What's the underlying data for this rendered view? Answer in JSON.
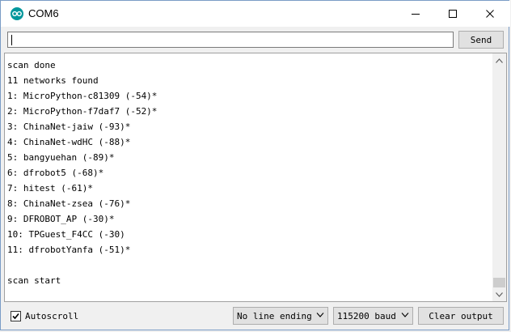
{
  "window": {
    "title": "COM6"
  },
  "input": {
    "value": ""
  },
  "buttons": {
    "send": "Send",
    "clear": "Clear output"
  },
  "output": {
    "lines": [
      "scan done",
      "11 networks found",
      "1: MicroPython-c81309 (-54)*",
      "2: MicroPython-f7daf7 (-52)*",
      "3: ChinaNet-jaiw (-93)*",
      "4: ChinaNet-wdHC (-88)*",
      "5: bangyuehan (-89)*",
      "6: dfrobot5 (-68)*",
      "7: hitest (-61)*",
      "8: ChinaNet-zsea (-76)*",
      "9: DFROBOT_AP (-30)*",
      "10: TPGuest_F4CC (-30)",
      "11: dfrobotYanfa (-51)*",
      "",
      "scan start"
    ]
  },
  "footer": {
    "autoscroll_label": "Autoscroll",
    "autoscroll_checked": true,
    "line_ending": "No line ending",
    "baud": "115200 baud"
  },
  "colors": {
    "accent": "#00979c"
  },
  "icons": {
    "app": "arduino-icon",
    "minimize": "minimize-icon",
    "maximize": "maximize-icon",
    "close": "close-icon",
    "check": "check-icon",
    "dropdown": "chevron-down-icon"
  }
}
